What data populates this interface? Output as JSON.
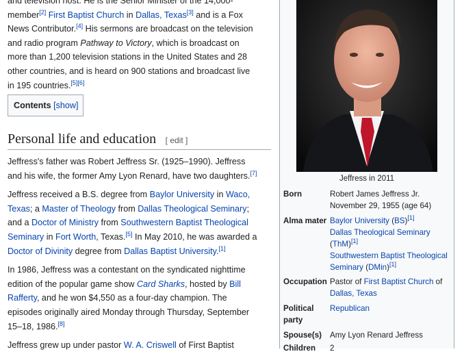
{
  "article": {
    "intro_line0": "and television host. He is the Senior Minister of the 14,000-",
    "intro_l1_a": "member",
    "intro_l1_ref2": "[2]",
    "intro_l1_link1": "First Baptist Church",
    "intro_l1_in": " in ",
    "intro_l1_link2": "Dallas, Texas",
    "intro_l1_ref3": "[3]",
    "intro_l1_b": " and is a Fox",
    "intro_l2_a": "News Contributor.",
    "intro_l2_ref4": "[4]",
    "intro_l2_b": " His sermons are broadcast on the television",
    "intro_l3_a": "and radio program ",
    "intro_l3_em": "Pathway to Victory",
    "intro_l3_b": ", which is broadcast on",
    "intro_l4": "more than 1,200 television stations in the United States and 28",
    "intro_l5": "other countries, and is heard on 900 stations and broadcast live",
    "intro_l6_a": "in 195 countries.",
    "intro_l6_ref": "[5][6]",
    "contents_label": "Contents",
    "contents_show": "[show]",
    "section_title": "Personal life and education",
    "section_edit": "[ edit ]",
    "p1_l1": "Jeffress's father was Robert Jeffress Sr. (1925–1990). Jeffress",
    "p1_l2_a": "and his wife, the former Amy Lyon Renard, have two daughters.",
    "p1_l2_ref": "[7]",
    "p2_l1_a": "Jeffress received a B.S. degree from ",
    "p2_l1_link1": "Baylor University",
    "p2_l1_b": " in ",
    "p2_l1_link2": "Waco,",
    "p2_l2_link1": "Texas",
    "p2_l2_a": "; a ",
    "p2_l2_link2": "Master of Theology",
    "p2_l2_b": " from ",
    "p2_l2_link3": "Dallas Theological Seminary",
    "p2_l2_c": ";",
    "p2_l3_a": "and a ",
    "p2_l3_link1": "Doctor of Ministry",
    "p2_l3_b": " from ",
    "p2_l3_link2": "Southwestern Baptist Theological",
    "p2_l4_link1": "Seminary",
    "p2_l4_a": " in ",
    "p2_l4_link2": "Fort Worth",
    "p2_l4_b": ", Texas.",
    "p2_l4_ref": "[5]",
    "p2_l4_c": " In May 2010, he was awarded a",
    "p2_l5_link1": "Doctor of Divinity",
    "p2_l5_a": " degree from ",
    "p2_l5_link2": "Dallas Baptist University",
    "p2_l5_b": ".",
    "p2_l5_ref": "[1]",
    "p3_l1": "In 1986, Jeffress was a contestant on the syndicated nighttime",
    "p3_l2_a": "edition of the popular game show ",
    "p3_l2_link1": "Card Sharks",
    "p3_l2_b": ", hosted by ",
    "p3_l2_link2": "Bill",
    "p3_l3_link": "Rafferty",
    "p3_l3_a": ", and he won $4,550 as a four-day champion. The",
    "p3_l4": "episodes originally aired Monday through Thursday, September",
    "p3_l5_a": "15–18, 1986.",
    "p3_l5_ref": "[8]",
    "p4_l1_a": "Jeffress grew up under pastor ",
    "p4_l1_link": "W. A. Criswell",
    "p4_l1_b": " of First Baptist"
  },
  "infobox": {
    "caption": "Jeffress in 2011",
    "born_label": "Born",
    "born_v1": "Robert James Jeffress Jr.",
    "born_v2": "November 29, 1955 (age 64)",
    "alma_label": "Alma mater",
    "alma_1_link": "Baylor University",
    "alma_1_b": " (",
    "alma_1_bs": "BS",
    "alma_1_c": ")",
    "alma_1_ref": "[1]",
    "alma_2_link": "Dallas Theological Seminary",
    "alma_2_b": "(",
    "alma_2_thm": "ThM",
    "alma_2_c": ")",
    "alma_2_ref": "[1]",
    "alma_3_link": "Southwestern Baptist Theological",
    "alma_3_link2": "Seminary",
    "alma_3_b": " (",
    "alma_3_dmin": "DMin",
    "alma_3_c": ")",
    "alma_3_ref": "[1]",
    "occ_label": "Occupation",
    "occ_a": "Pastor of ",
    "occ_link1": "First Baptist Church",
    "occ_b": " of",
    "occ_link2": "Dallas, Texas",
    "party_label_1": "Political",
    "party_label_2": "party",
    "party_value": "Republican",
    "spouse_label": "Spouse(s)",
    "spouse_value": "Amy Lyon Renard Jeffress",
    "children_label": "Children",
    "children_value": "2"
  },
  "colors": {
    "link": "#0645ad",
    "infobox_bg": "#f8f9fa",
    "border": "#a2a9b1"
  }
}
